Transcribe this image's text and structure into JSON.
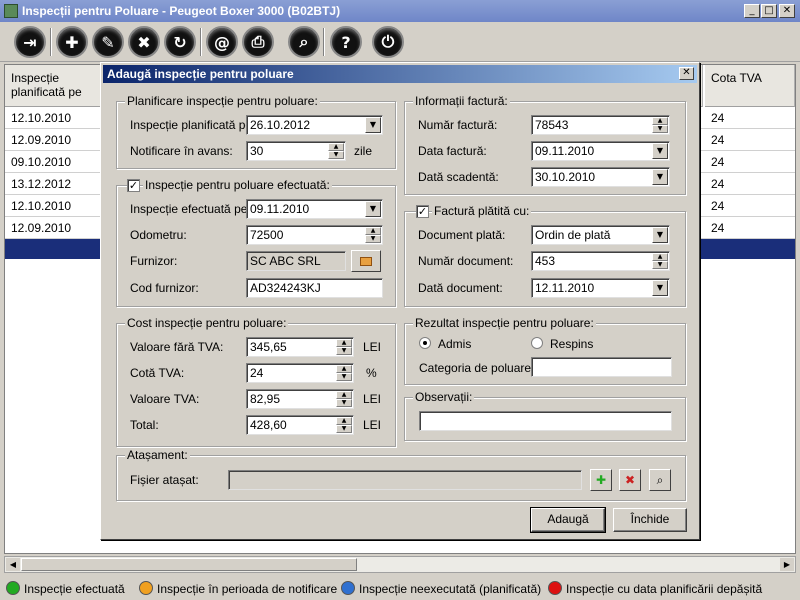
{
  "window": {
    "title": "Inspecții pentru Poluare - Peugeot Boxer 3000 (B02BTJ)",
    "minimize": "_",
    "maximize": "□",
    "close": "✕"
  },
  "toolbar": {
    "buttons": [
      {
        "icon": "exit-icon",
        "glyph": "⇥"
      },
      {
        "icon": "add-icon",
        "glyph": "✚"
      },
      {
        "icon": "edit-icon",
        "glyph": "✎"
      },
      {
        "icon": "delete-icon",
        "glyph": "✖"
      },
      {
        "icon": "refresh-icon",
        "glyph": "↻"
      },
      {
        "icon": "email-icon",
        "glyph": "@"
      },
      {
        "icon": "print-icon",
        "glyph": "⎙"
      },
      {
        "icon": "search-icon",
        "glyph": "⌕"
      },
      {
        "icon": "help-icon",
        "glyph": "?"
      },
      {
        "icon": "power-icon",
        "glyph": "⏻"
      }
    ]
  },
  "grid": {
    "col1_header": "Inspecție planificată pe",
    "col2_header": "Cota TVA",
    "rows": [
      {
        "date": "12.10.2010",
        "vat": "24"
      },
      {
        "date": "12.09.2010",
        "vat": "24"
      },
      {
        "date": "09.10.2010",
        "vat": "24"
      },
      {
        "date": "13.12.2012",
        "vat": "24"
      },
      {
        "date": "12.10.2010",
        "vat": "24"
      },
      {
        "date": "12.09.2010",
        "vat": "24"
      }
    ]
  },
  "legend": [
    {
      "label": "Inspecție efectuată",
      "color": "#22aa22"
    },
    {
      "label": "Inspecție în perioada de notificare",
      "color": "#f0a020"
    },
    {
      "label": "Inspecție neexecutată (planificată)",
      "color": "#3070d0"
    },
    {
      "label": "Inspecție cu data planificării depășită",
      "color": "#dd1111"
    }
  ],
  "dialog": {
    "title": "Adaugă inspecție pentru poluare",
    "close": "✕",
    "planning": {
      "legend": "Planificare inspecție pentru poluare:",
      "planned_label": "Inspecție planificată pe:",
      "planned_value": "26.10.2012",
      "notice_label": "Notificare în avans:",
      "notice_value": "30",
      "notice_unit": "zile"
    },
    "done": {
      "legend": "Inspecție pentru poluare efectuată:",
      "checked": "✓",
      "done_label": "Inspecție efectuată pe:",
      "done_value": "09.11.2010",
      "odometer_label": "Odometru:",
      "odometer_value": "72500",
      "supplier_label": "Furnizor:",
      "supplier_value": "SC ABC SRL",
      "supplier_code_label": "Cod furnizor:",
      "supplier_code_value": "AD324243KJ"
    },
    "cost": {
      "legend": "Cost inspecție pentru poluare:",
      "net_label": "Valoare fără TVA:",
      "net_value": "345,65",
      "net_unit": "LEI",
      "vat_rate_label": "Cotă TVA:",
      "vat_rate_value": "24",
      "vat_rate_unit": "%",
      "vat_label": "Valoare TVA:",
      "vat_value": "82,95",
      "vat_unit": "LEI",
      "total_label": "Total:",
      "total_value": "428,60",
      "total_unit": "LEI"
    },
    "invoice": {
      "legend": "Informații factură:",
      "number_label": "Număr factură:",
      "number_value": "78543",
      "date_label": "Data factură:",
      "date_value": "09.11.2010",
      "due_label": "Dată scadentă:",
      "due_value": "30.10.2010"
    },
    "paid": {
      "legend": "Factură plătită cu:",
      "checked": "✓",
      "doc_label": "Document plată:",
      "doc_value": "Ordin de plată",
      "docno_label": "Număr document:",
      "docno_value": "453",
      "docdate_label": "Dată document:",
      "docdate_value": "12.11.2010"
    },
    "result": {
      "legend": "Rezultat inspecție pentru poluare:",
      "pass_label": "Admis",
      "fail_label": "Respins",
      "category_label": "Categoria de poluare:",
      "category_value": ""
    },
    "notes": {
      "legend": "Observații:",
      "value": ""
    },
    "attachment": {
      "legend": "Atașament:",
      "file_label": "Fișier atașat:",
      "file_value": ""
    },
    "add_button": "Adaugă",
    "close_button": "Închide"
  }
}
